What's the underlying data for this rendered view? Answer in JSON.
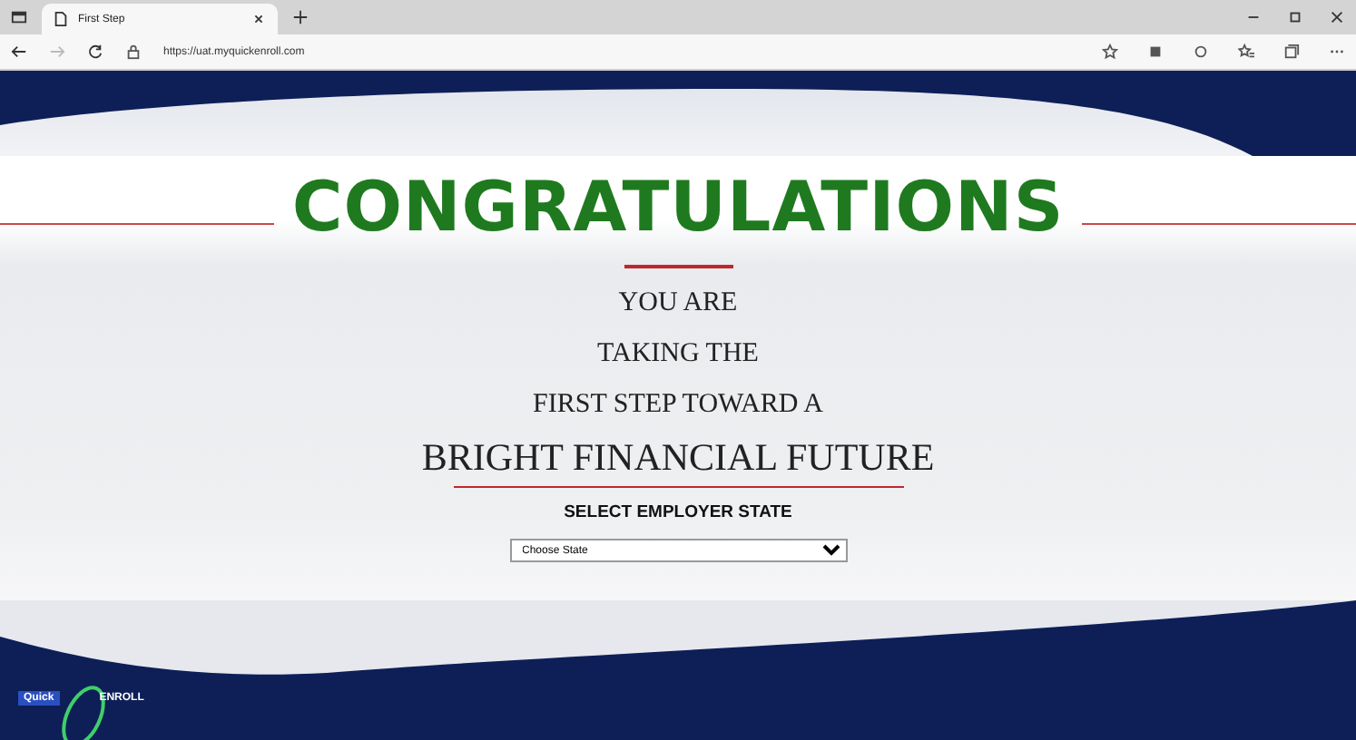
{
  "browser": {
    "tab": {
      "title": "First Step",
      "selected": true
    },
    "address": "https://uat.myquickenroll.com"
  },
  "page": {
    "heading": "CONGRATULATIONS",
    "lines": [
      {
        "text": "YOU ARE",
        "kind": "normal"
      },
      {
        "text": "TAKING THE",
        "kind": "normal"
      },
      {
        "text": "FIRST STEP TOWARD A",
        "kind": "normal"
      },
      {
        "text": "BRIGHT FINANCIAL FUTURE",
        "kind": "large"
      }
    ],
    "select_label": "SELECT EMPLOYER STATE",
    "state_select": {
      "value": "Choose State"
    }
  },
  "logo": {
    "word_1": "Quick",
    "word_2": "ENROLL"
  }
}
